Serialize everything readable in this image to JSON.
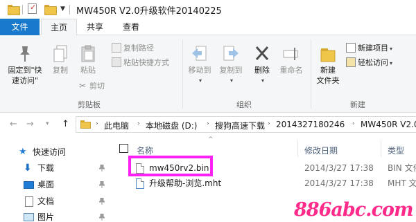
{
  "window": {
    "title": "MW450R V2.0升级软件20140225"
  },
  "ribbon": {
    "tabs": {
      "file": "文件",
      "home": "主页",
      "share": "共享",
      "view": "查看"
    },
    "clipboard": {
      "pin_line1": "固定到\"快",
      "pin_line2": "速访问\"",
      "copy": "复制",
      "paste": "粘贴",
      "copy_path": "复制路径",
      "paste_shortcut": "粘贴快捷方式",
      "cut": "剪切",
      "group_label": "剪贴板"
    },
    "organize": {
      "move_to": "移动到",
      "copy_to": "复制到",
      "delete": "删除",
      "rename": "重命名",
      "group_label": "组织"
    },
    "new": {
      "new_folder_line1": "新建",
      "new_folder_line2": "文件夹",
      "new_item": "新建项目",
      "easy_access": "轻松访问",
      "group_label": "新建"
    }
  },
  "address": {
    "crumbs": [
      "此电脑",
      "本地磁盘 (D:)",
      "搜狗高速下载",
      "2014327180246",
      "MW450R V2.0"
    ]
  },
  "nav": {
    "items": [
      {
        "label": "快速访问",
        "icon": "star-icon"
      },
      {
        "label": "下载",
        "icon": "download-arrow-icon"
      },
      {
        "label": "桌面",
        "icon": "desktop-icon"
      },
      {
        "label": "文档",
        "icon": "document-icon"
      },
      {
        "label": "图片",
        "icon": "pictures-icon"
      }
    ]
  },
  "list": {
    "columns": {
      "name": "名称",
      "modified": "修改日期",
      "type": "类型"
    },
    "rows": [
      {
        "name": "mw450rv2.bin",
        "modified": "2014/3/27 17:38",
        "type": "BIN 文件"
      },
      {
        "name": "升级帮助-浏览.mht",
        "modified": "2014/3/27 17:38",
        "type": "MHT 文件"
      }
    ]
  },
  "watermark": "886abc.com",
  "colors": {
    "accent": "#1979ca",
    "highlight": "#ff22f4",
    "watermark": "#ff2a8a",
    "folder": "#f0c64a"
  }
}
